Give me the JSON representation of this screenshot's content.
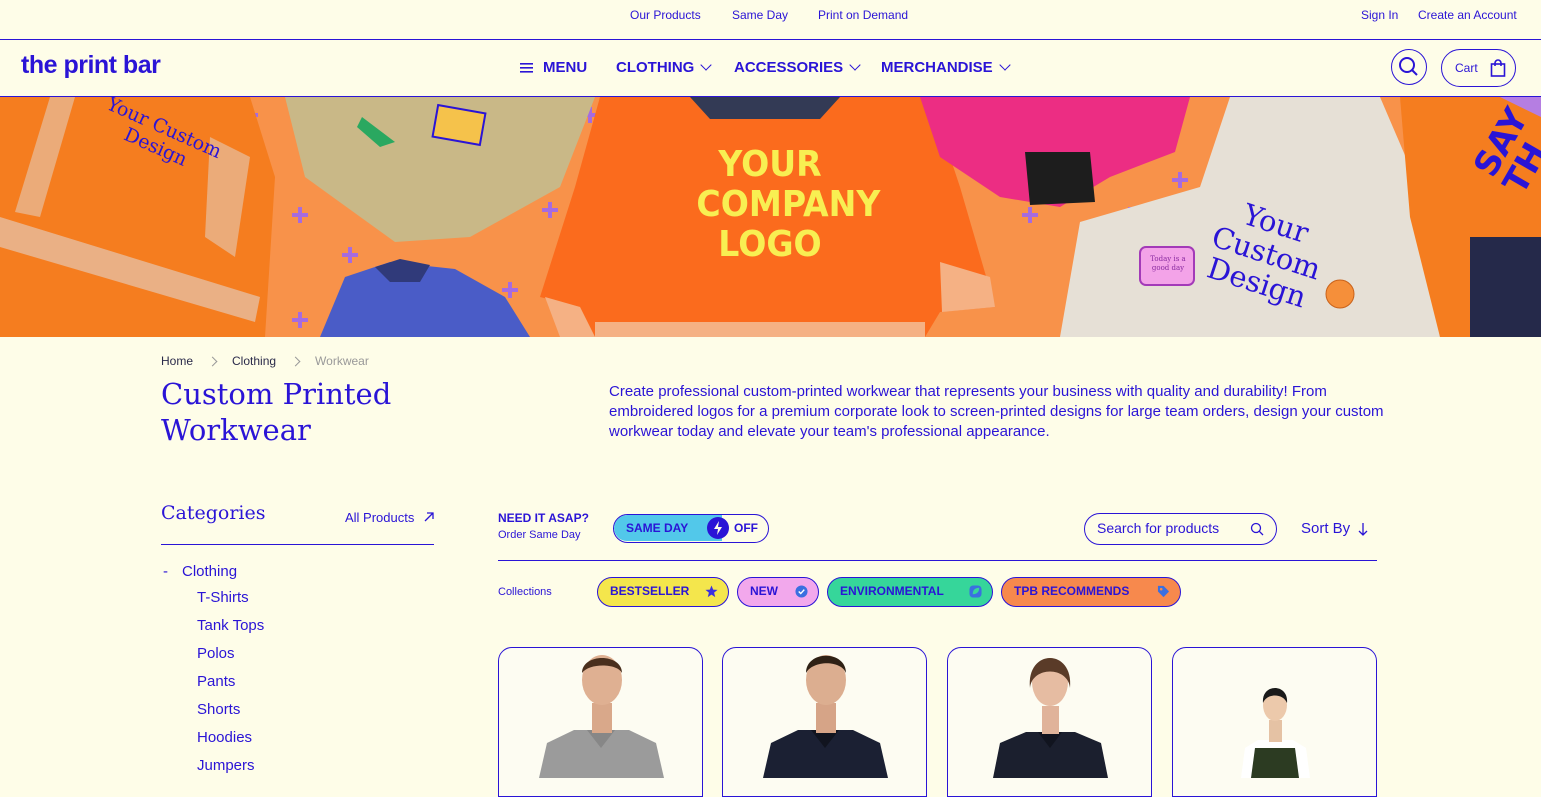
{
  "topbar": {
    "links": [
      "Our Products",
      "Same Day",
      "Print on Demand"
    ],
    "sign_in": "Sign In",
    "create_account": "Create an Account"
  },
  "nav": {
    "logo": "the print bar",
    "menu": "MENU",
    "clothing": "CLOTHING",
    "accessories": "ACCESSORIES",
    "merchandise": "MERCHANDISE",
    "cart": "Cart"
  },
  "hero": {
    "logo_text": [
      "YOUR",
      "COMPANY",
      "LOGO"
    ],
    "custom_design": [
      "Your",
      "Custom",
      "Design"
    ],
    "custom_design_small": [
      "Your Custom",
      "Design"
    ],
    "sticker": [
      "Today is a",
      "good day"
    ],
    "side_text": [
      "SAY",
      "TH"
    ]
  },
  "breadcrumb": [
    "Home",
    "Clothing",
    "Workwear"
  ],
  "page": {
    "title_line1": "Custom Printed",
    "title_line2": "Workwear",
    "description": "Create professional custom-printed workwear that represents your business with quality and durability! From embroidered logos for a premium corporate look to screen-printed designs for large team orders, design your custom workwear today and elevate your team's professional appearance."
  },
  "categories": {
    "heading": "Categories",
    "all_products": "All Products",
    "current": "Clothing",
    "current_marker": "-",
    "items": [
      "T-Shirts",
      "Tank Tops",
      "Polos",
      "Pants",
      "Shorts",
      "Hoodies",
      "Jumpers"
    ]
  },
  "filters": {
    "asap_title": "NEED IT ASAP?",
    "asap_sub": "Order Same Day",
    "same_day_label": "SAME DAY",
    "same_day_state": "OFF",
    "search_placeholder": "Search for products",
    "sort_label": "Sort By",
    "collections_label": "Collections",
    "collections": [
      {
        "label": "BESTSELLER",
        "color": "#f4e64c",
        "icon": "star-icon"
      },
      {
        "label": "NEW",
        "color": "#f2a8ec",
        "icon": "verified-badge-icon"
      },
      {
        "label": "ENVIRONMENTAL",
        "color": "#36d69a",
        "icon": "leaf-icon"
      },
      {
        "label": "TPB RECOMMENDS",
        "color": "#f7894d",
        "icon": "tag-icon"
      }
    ]
  },
  "products": [
    {
      "name": "grey-polo",
      "color": "#9b9b9b"
    },
    {
      "name": "navy-polo",
      "color": "#1b2033"
    },
    {
      "name": "womens-navy-polo",
      "color": "#1b1f2e"
    },
    {
      "name": "green-apron",
      "color": "#2c3b22"
    }
  ],
  "colors": {
    "primary": "#2a14d6",
    "background": "#fefde8",
    "hero_orange": "#f8924a",
    "plus_purple": "#a66bdf"
  }
}
